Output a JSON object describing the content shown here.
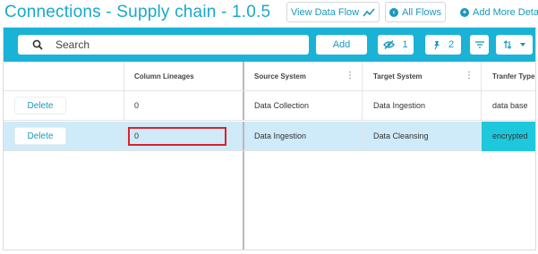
{
  "header": {
    "title": "Connections - Supply chain - 1.0.5",
    "view_data_flow_label": "View Data Flow",
    "all_flows_label": "All Flows",
    "add_more_details_label": "Add More Details"
  },
  "toolbar": {
    "search_placeholder": "Search",
    "add_label": "Add",
    "hidden_count": "1",
    "pinned_count": "2"
  },
  "table": {
    "columns": [
      "",
      "Column Lineages",
      "Source System",
      "Target System",
      "Tranfer Type"
    ],
    "rows": [
      {
        "action": "Delete",
        "column_lineages": "0",
        "source_system": "Data Collection",
        "target_system": "Data Ingestion",
        "transfer_type": "data base",
        "selected": false
      },
      {
        "action": "Delete",
        "column_lineages": "0",
        "source_system": "Data Ingestion",
        "target_system": "Data Cleansing",
        "transfer_type": "encrypted",
        "selected": true
      }
    ]
  },
  "colors": {
    "accent": "#1ab3d6",
    "link": "#1a98bd",
    "selected_row": "#cfeaf8",
    "selected_cell": "#1ec8dc",
    "highlight_box": "#d9232e"
  }
}
